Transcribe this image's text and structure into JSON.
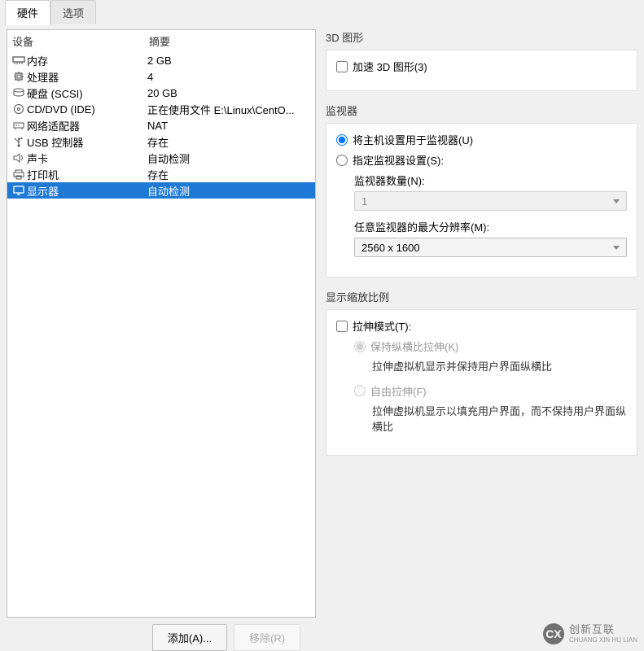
{
  "tabs": {
    "hardware": "硬件",
    "options": "选项"
  },
  "hw_headers": {
    "device": "设备",
    "summary": "摘要"
  },
  "hardware_list": [
    {
      "icon": "memory",
      "name": "内存",
      "summary": "2 GB"
    },
    {
      "icon": "cpu",
      "name": "处理器",
      "summary": "4"
    },
    {
      "icon": "disk",
      "name": "硬盘 (SCSI)",
      "summary": "20 GB"
    },
    {
      "icon": "cd",
      "name": "CD/DVD (IDE)",
      "summary": "正在使用文件 E:\\Linux\\CentO..."
    },
    {
      "icon": "net",
      "name": "网络适配器",
      "summary": "NAT"
    },
    {
      "icon": "usb",
      "name": "USB 控制器",
      "summary": "存在"
    },
    {
      "icon": "sound",
      "name": "声卡",
      "summary": "自动检测"
    },
    {
      "icon": "printer",
      "name": "打印机",
      "summary": "存在"
    },
    {
      "icon": "display",
      "name": "显示器",
      "summary": "自动检测"
    }
  ],
  "buttons": {
    "add": "添加(A)...",
    "remove": "移除(R)"
  },
  "right": {
    "section_3d": "3D 图形",
    "accel_3d": "加速 3D 图形(3)",
    "monitor_section": "监视器",
    "use_host": "将主机设置用于监视器(U)",
    "specify": "指定监视器设置(S):",
    "monitor_count_label": "监视器数量(N):",
    "monitor_count_value": "1",
    "max_res_label": "任意监视器的最大分辨率(M):",
    "max_res_value": "2560 x 1600",
    "scale_section": "显示缩放比例",
    "stretch_mode": "拉伸模式(T):",
    "keep_aspect": "保持纵横比拉伸(K)",
    "keep_aspect_desc": "拉伸虚拟机显示并保持用户界面纵横比",
    "free_stretch": "自由拉伸(F)",
    "free_stretch_desc": "拉伸虚拟机显示以填充用户界面，而不保持用户界面纵横比"
  },
  "watermark": {
    "cn": "创新互联",
    "en": "CHUANG XIN HU LIAN",
    "logo": "CX"
  }
}
